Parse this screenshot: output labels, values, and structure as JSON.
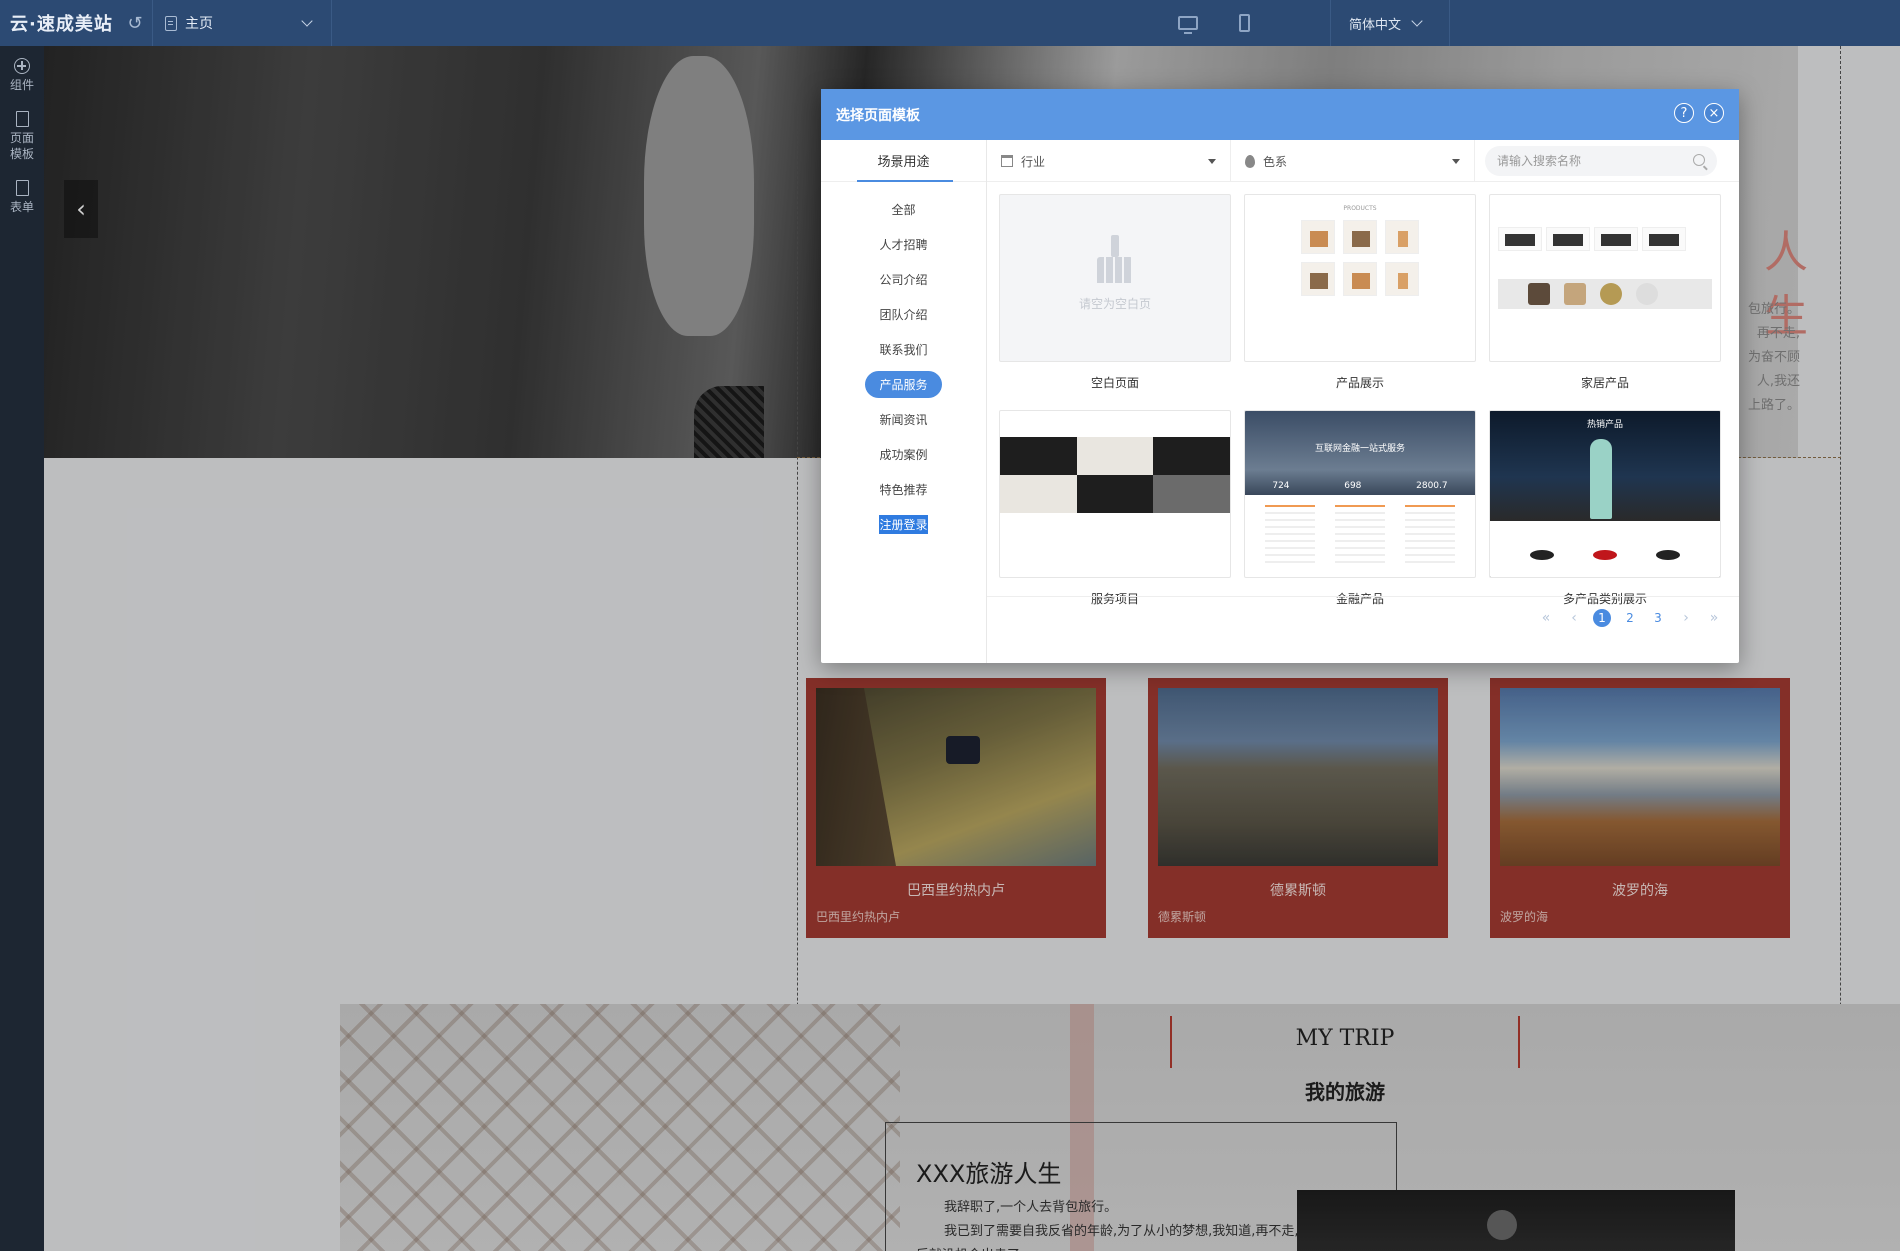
{
  "topbar": {
    "logo": "云·速成美站",
    "page_selector_label": "主页",
    "language_label": "简体中文",
    "background_color": "#2c4a73"
  },
  "sidebar": {
    "items": [
      {
        "icon": "add-component-icon",
        "label": "组件"
      },
      {
        "icon": "page-template-icon",
        "label": "页面模板"
      },
      {
        "icon": "form-icon",
        "label": "表单"
      }
    ]
  },
  "canvas": {
    "hero": {
      "heading": "人生",
      "lines": [
        "包旅行。",
        "再不走,",
        "为奋不顾",
        "人,我还",
        "上路了。"
      ]
    },
    "cards": [
      {
        "title": "巴西里约热内卢",
        "subtitle": "巴西里约热内卢"
      },
      {
        "title": "德累斯顿",
        "subtitle": "德累斯顿"
      },
      {
        "title": "波罗的海",
        "subtitle": "波罗的海"
      }
    ],
    "trip": {
      "title_en": "MY TRIP",
      "title_cn": "我的旅游",
      "box_title": "XXX旅游人生",
      "paragraph_1": "我辞职了,一个人去背包旅行。",
      "paragraph_2": "我已到了需要自我反省的年龄,为了从小的梦想,我知道,再不走,以后就没机会出走了。"
    },
    "accent_color": "#a23a31"
  },
  "modal": {
    "title": "选择页面模板",
    "help_label": "?",
    "close_label": "×",
    "left_tab": "场景用途",
    "categories": [
      "全部",
      "人才招聘",
      "公司介绍",
      "团队介绍",
      "联系我们",
      "产品服务",
      "新闻资讯",
      "成功案例",
      "特色推荐",
      "注册登录"
    ],
    "active_category": "产品服务",
    "filters": {
      "industry_label": "行业",
      "color_label": "色系",
      "search_placeholder": "请输入搜索名称"
    },
    "templates": [
      {
        "name": "空白页面",
        "thumb_text": "请空为空白页"
      },
      {
        "name": "产品展示",
        "thumb_text": "PRODUCTS"
      },
      {
        "name": "家居产品",
        "thumb_text": ""
      },
      {
        "name": "服务项目",
        "thumb_text": ""
      },
      {
        "name": "金融产品",
        "thumb_text": "互联网金融一站式服务",
        "stats": [
          "724",
          "698",
          "2800.7"
        ]
      },
      {
        "name": "多产品类别展示",
        "thumb_text": "热销产品"
      }
    ],
    "pagination": {
      "first": "«",
      "prev": "‹",
      "pages": [
        "1",
        "2",
        "3"
      ],
      "current": "1",
      "next": "›",
      "last": "»"
    },
    "header_color": "#5b97e3",
    "accent_color": "#4a8be0"
  }
}
